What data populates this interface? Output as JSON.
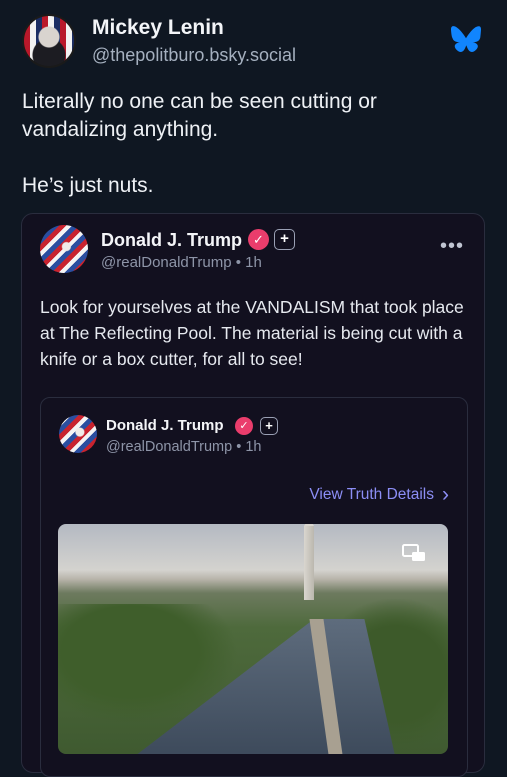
{
  "post": {
    "display_name": "Mickey Lenin",
    "handle": "@thepolitburo.bsky.social",
    "text_line1": "Literally no one can be seen cutting or vandalizing anything.",
    "text_line2": "He’s just nuts."
  },
  "embed": {
    "author_name": "Donald J. Trump",
    "author_meta": "@realDonaldTrump • 1h",
    "verified_glyph": "✓",
    "plus_glyph": "+",
    "more_glyph": "•••",
    "text": "Look for yourselves at the VANDALISM that took place at The Reflecting Pool. The material is being cut with a knife or a box cutter, for all to see!",
    "quote": {
      "author_name": "Donald J. Trump",
      "author_meta": "@realDonaldTrump • 1h",
      "view_details_label": "View Truth Details",
      "chevron": "›"
    }
  },
  "colors": {
    "background": "#0f1722",
    "bluesky_blue": "#1185fe",
    "verified_pink": "#ea3d6c",
    "link_purple": "#8c8ef5"
  },
  "icons": [
    "bluesky-butterfly-icon",
    "verified-icon",
    "plus-icon",
    "more-icon",
    "chevron-right-icon",
    "picture-in-picture-icon"
  ]
}
